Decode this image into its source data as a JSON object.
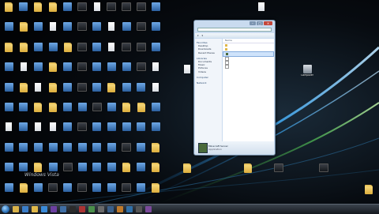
{
  "desktop": {
    "icons": [
      {
        "label": "",
        "kind": "folder"
      },
      {
        "label": "",
        "kind": "exe"
      },
      {
        "label": "",
        "kind": "folder"
      },
      {
        "label": "",
        "kind": "folder"
      },
      {
        "label": "",
        "kind": "exe"
      },
      {
        "label": "",
        "kind": "dark"
      },
      {
        "label": "",
        "kind": "doc"
      },
      {
        "label": "",
        "kind": "dark"
      },
      {
        "label": "",
        "kind": "dark"
      },
      {
        "label": "",
        "kind": "dark"
      },
      {
        "label": "",
        "kind": "exe"
      },
      {
        "label": "",
        "kind": "exe"
      },
      {
        "label": "",
        "kind": "folder"
      },
      {
        "label": "",
        "kind": "exe"
      },
      {
        "label": "",
        "kind": "doc"
      },
      {
        "label": "",
        "kind": "exe"
      },
      {
        "label": "",
        "kind": "dark"
      },
      {
        "label": "",
        "kind": "exe"
      },
      {
        "label": "",
        "kind": "doc"
      },
      {
        "label": "",
        "kind": "exe"
      },
      {
        "label": "",
        "kind": "dark"
      },
      {
        "label": "",
        "kind": "exe"
      },
      {
        "label": "",
        "kind": "folder"
      },
      {
        "label": "",
        "kind": "folder"
      },
      {
        "label": "",
        "kind": "exe"
      },
      {
        "label": "",
        "kind": "exe"
      },
      {
        "label": "",
        "kind": "folder"
      },
      {
        "label": "",
        "kind": "dark"
      },
      {
        "label": "",
        "kind": "exe"
      },
      {
        "label": "",
        "kind": "doc"
      },
      {
        "label": "",
        "kind": "dark"
      },
      {
        "label": "",
        "kind": "dark"
      },
      {
        "label": "",
        "kind": "exe"
      },
      {
        "label": "",
        "kind": "exe"
      },
      {
        "label": "",
        "kind": "doc"
      },
      {
        "label": "",
        "kind": "exe"
      },
      {
        "label": "",
        "kind": "folder"
      },
      {
        "label": "",
        "kind": "exe"
      },
      {
        "label": "",
        "kind": "dark"
      },
      {
        "label": "",
        "kind": "exe"
      },
      {
        "label": "",
        "kind": "exe"
      },
      {
        "label": "",
        "kind": "exe"
      },
      {
        "label": "",
        "kind": "dark"
      },
      {
        "label": "",
        "kind": "doc"
      },
      {
        "label": "",
        "kind": "exe"
      },
      {
        "label": "",
        "kind": "folder"
      },
      {
        "label": "",
        "kind": "doc"
      },
      {
        "label": "",
        "kind": "folder"
      },
      {
        "label": "",
        "kind": "exe"
      },
      {
        "label": "",
        "kind": "dark"
      },
      {
        "label": "",
        "kind": "exe"
      },
      {
        "label": "",
        "kind": "folder"
      },
      {
        "label": "",
        "kind": "exe"
      },
      {
        "label": "",
        "kind": "exe"
      },
      {
        "label": "",
        "kind": "doc"
      },
      {
        "label": "",
        "kind": "exe"
      },
      {
        "label": "",
        "kind": "exe"
      },
      {
        "label": "",
        "kind": "folder"
      },
      {
        "label": "",
        "kind": "folder"
      },
      {
        "label": "",
        "kind": "exe"
      },
      {
        "label": "",
        "kind": "exe"
      },
      {
        "label": "",
        "kind": "dark"
      },
      {
        "label": "",
        "kind": "exe"
      },
      {
        "label": "",
        "kind": "folder"
      },
      {
        "label": "",
        "kind": "folder"
      },
      {
        "label": "",
        "kind": "exe"
      },
      {
        "label": "",
        "kind": "doc"
      },
      {
        "label": "",
        "kind": "exe"
      },
      {
        "label": "",
        "kind": "doc"
      },
      {
        "label": "",
        "kind": "doc"
      },
      {
        "label": "",
        "kind": "exe"
      },
      {
        "label": "",
        "kind": "dark"
      },
      {
        "label": "",
        "kind": "exe"
      },
      {
        "label": "",
        "kind": "exe"
      },
      {
        "label": "",
        "kind": "exe"
      },
      {
        "label": "",
        "kind": "exe"
      },
      {
        "label": "",
        "kind": "exe"
      },
      {
        "label": "",
        "kind": "exe"
      },
      {
        "label": "",
        "kind": "exe"
      },
      {
        "label": "",
        "kind": "exe"
      },
      {
        "label": "",
        "kind": "exe"
      },
      {
        "label": "",
        "kind": "exe"
      },
      {
        "label": "",
        "kind": "exe"
      },
      {
        "label": "",
        "kind": "exe"
      },
      {
        "label": "",
        "kind": "exe"
      },
      {
        "label": "",
        "kind": "dark"
      },
      {
        "label": "",
        "kind": "exe"
      },
      {
        "label": "",
        "kind": "folder"
      },
      {
        "label": "",
        "kind": "exe"
      },
      {
        "label": "",
        "kind": "exe"
      },
      {
        "label": "",
        "kind": "folder"
      },
      {
        "label": "",
        "kind": "exe"
      },
      {
        "label": "",
        "kind": "dark"
      },
      {
        "label": "",
        "kind": "exe"
      },
      {
        "label": "",
        "kind": "exe"
      },
      {
        "label": "",
        "kind": "exe"
      },
      {
        "label": "",
        "kind": "folder"
      },
      {
        "label": "",
        "kind": "exe"
      },
      {
        "label": "",
        "kind": "folder"
      },
      {
        "label": "",
        "kind": "exe"
      },
      {
        "label": "",
        "kind": "folder"
      },
      {
        "label": "",
        "kind": "exe"
      },
      {
        "label": "",
        "kind": "dark"
      },
      {
        "label": "",
        "kind": "exe"
      },
      {
        "label": "",
        "kind": "dark"
      },
      {
        "label": "",
        "kind": "exe"
      },
      {
        "label": "",
        "kind": "exe"
      },
      {
        "label": "",
        "kind": "dark"
      },
      {
        "label": "",
        "kind": "exe"
      },
      {
        "label": "",
        "kind": "folder"
      }
    ],
    "free_icons": [
      {
        "label": "",
        "kind": "doc"
      },
      {
        "label": "",
        "kind": "doc"
      },
      {
        "label": "Computer",
        "kind": "exe"
      },
      {
        "label": "",
        "kind": "folder"
      },
      {
        "label": "",
        "kind": "folder"
      },
      {
        "label": "",
        "kind": "dark"
      },
      {
        "label": "",
        "kind": "dark"
      },
      {
        "label": "",
        "kind": "folder"
      }
    ],
    "watermark": "Windows Vista"
  },
  "explorer": {
    "nav": [
      "Favorites",
      "Desktop",
      "Downloads",
      "Recent Places",
      "Libraries",
      "Documents",
      "Music",
      "Pictures",
      "Videos",
      "Computer",
      "Network"
    ],
    "column_header": "Name",
    "files": [
      {
        "name": "",
        "selected": false
      },
      {
        "name": "",
        "selected": false
      },
      {
        "name": "",
        "selected": true
      },
      {
        "name": "",
        "selected": false
      },
      {
        "name": "",
        "selected": false
      },
      {
        "name": "",
        "selected": false
      }
    ],
    "details": {
      "name": "Minecraft Server",
      "type": "Application"
    }
  },
  "taskbar": {
    "buttons": [
      "explorer",
      "media",
      "folder",
      "ie",
      "app1",
      "app2",
      "app3",
      "app4",
      "app5",
      "app6",
      "app7",
      "app8",
      "app9",
      "app10",
      "app11"
    ],
    "clock_time": "",
    "clock_date": ""
  },
  "colors": {
    "accent": "#3f8fd9",
    "taskbar": "#1c2127"
  }
}
